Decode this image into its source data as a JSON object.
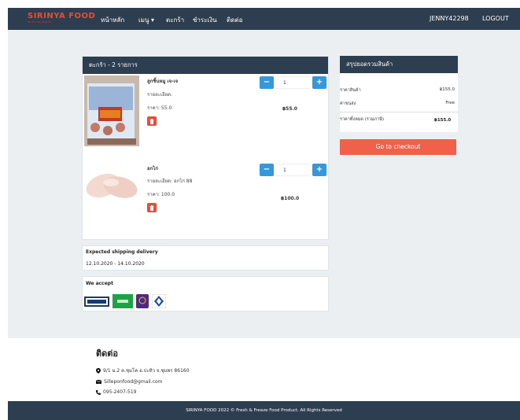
{
  "brand": {
    "name": "SIRINYA FOOD",
    "tagline": "สด สะอาด ปลอดภัย"
  },
  "nav": {
    "home": "หน้าหลัก",
    "menu": "เมนู",
    "cart": "ตะกร้า",
    "payment": "ชำระเงิน",
    "contact": "ติดต่อ",
    "user": "JENNY42298",
    "logout": "LOGOUT"
  },
  "cart": {
    "title": "ตะกร้า - 2 รายการ",
    "items": [
      {
        "name": "ลูกชิ้นหมู เจ-เจ",
        "detail": "รายละเอียด.",
        "price_label": "ราคา: 55.0",
        "quantity": "1",
        "total": "฿55.0"
      },
      {
        "name": "อกไก่",
        "detail": "รายละเอียด: อกไก่ 88",
        "price_label": "ราคา: 100.0",
        "quantity": "1",
        "total": "฿100.0"
      }
    ]
  },
  "shipping": {
    "title": "Expected shipping delivery",
    "dates": "12.10.2020 - 14.10.2020"
  },
  "payment": {
    "title": "We accept",
    "logos": [
      "PromptPay",
      "Bank",
      "SCB",
      "Krungsri"
    ]
  },
  "summary": {
    "title": "สรุปยอดรวมสินค้า",
    "rows": [
      {
        "label": "ราคาสินค้า",
        "value": "฿155.0"
      },
      {
        "label": "ค่าขนส่ง",
        "value": "Free"
      },
      {
        "label": "ราคาทั้งหมด (รวมภาษี)",
        "value": "฿155.0"
      }
    ],
    "checkout": "Go to checkout"
  },
  "contact": {
    "title": "ติดต่อ",
    "address": "9/1 ม.2 ต.ชุมโค อ.ปะทิว จ.ชุมพร 86160",
    "email": "Silleponfood@gmail.com",
    "phone": "095-2407-519"
  },
  "footer": {
    "text": "SIRINYA FOOD 2022 © Fresh & Freeze Food Product. All Rights Reserved"
  },
  "colors": {
    "navbar": "#2c3e50",
    "brand": "#e74c3c",
    "primary_button": "#3498db",
    "checkout": "#f0604a",
    "delete": "#e74c3c"
  }
}
